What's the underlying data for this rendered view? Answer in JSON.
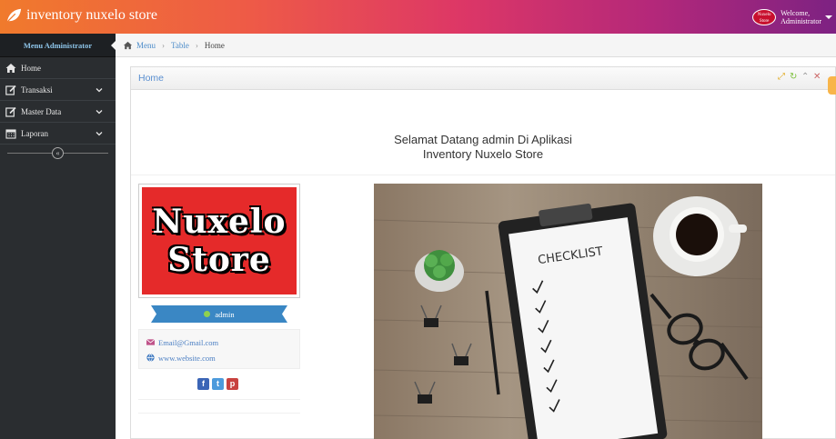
{
  "app": {
    "brand": "inventory nuxelo store"
  },
  "user": {
    "avatar_text_1": "Nuxelo",
    "avatar_text_2": "Store",
    "welcome": "Welcome,",
    "name": "Administrator"
  },
  "sidebar": {
    "heading": "Menu Administrator",
    "items": [
      {
        "label": "Home",
        "icon": "home-icon"
      },
      {
        "label": "Transaksi",
        "icon": "edit-icon"
      },
      {
        "label": "Master Data",
        "icon": "edit-icon"
      },
      {
        "label": "Laporan",
        "icon": "calendar-icon"
      }
    ],
    "collapse_glyph": "«"
  },
  "breadcrumb": {
    "items": [
      "Menu",
      "Table",
      "Home"
    ],
    "separator": "›"
  },
  "widget": {
    "title": "Home"
  },
  "main": {
    "welcome_line1": "Selamat Datang admin Di Aplikasi",
    "welcome_line2": "Inventory Nuxelo Store"
  },
  "profile": {
    "logo_line1": "Nuxelo",
    "logo_line2": "Store",
    "username": "admin",
    "email": "Email@Gmail.com",
    "website": "www.website.com",
    "social": {
      "facebook": "f",
      "twitter": "t",
      "pinterest": "p"
    }
  },
  "photo": {
    "checklist_title": "CHECKLIST"
  },
  "colors": {
    "sidebar": "#2a2d30",
    "accent": "#3a87c4",
    "brand_red": "#e52a2a"
  }
}
